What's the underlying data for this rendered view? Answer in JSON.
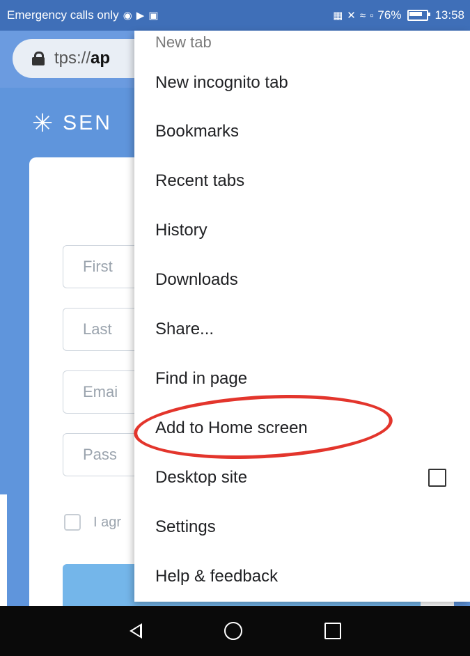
{
  "status_bar": {
    "carrier_text": "Emergency calls only",
    "left_icons": [
      "browser-icon",
      "arrow-icon",
      "gallery-icon"
    ],
    "battery_text": "76%",
    "time": "13:58",
    "right_icons": [
      "nfc-icon",
      "mute-icon",
      "wifi-icon",
      "battery-saver-icon",
      "battery-icon"
    ]
  },
  "url_bar": {
    "prefix": "tps://",
    "domain": "ap"
  },
  "page": {
    "logo_text": "SEN",
    "fields": [
      {
        "placeholder": "First"
      },
      {
        "placeholder": "Last"
      },
      {
        "placeholder": "Emai"
      },
      {
        "placeholder": "Pass"
      }
    ],
    "agree_text": "I agr"
  },
  "menu": {
    "partial_item": "New tab",
    "items": [
      {
        "label": "New incognito tab"
      },
      {
        "label": "Bookmarks"
      },
      {
        "label": "Recent tabs"
      },
      {
        "label": "History"
      },
      {
        "label": "Downloads"
      },
      {
        "label": "Share..."
      },
      {
        "label": "Find in page"
      },
      {
        "label": "Add to Home screen"
      },
      {
        "label": "Desktop site",
        "checkbox": false
      },
      {
        "label": "Settings"
      },
      {
        "label": "Help & feedback"
      }
    ]
  },
  "colors": {
    "annotation": "#e3352c",
    "page_bg": "#5f95dc",
    "submit": "#74b6ea"
  }
}
